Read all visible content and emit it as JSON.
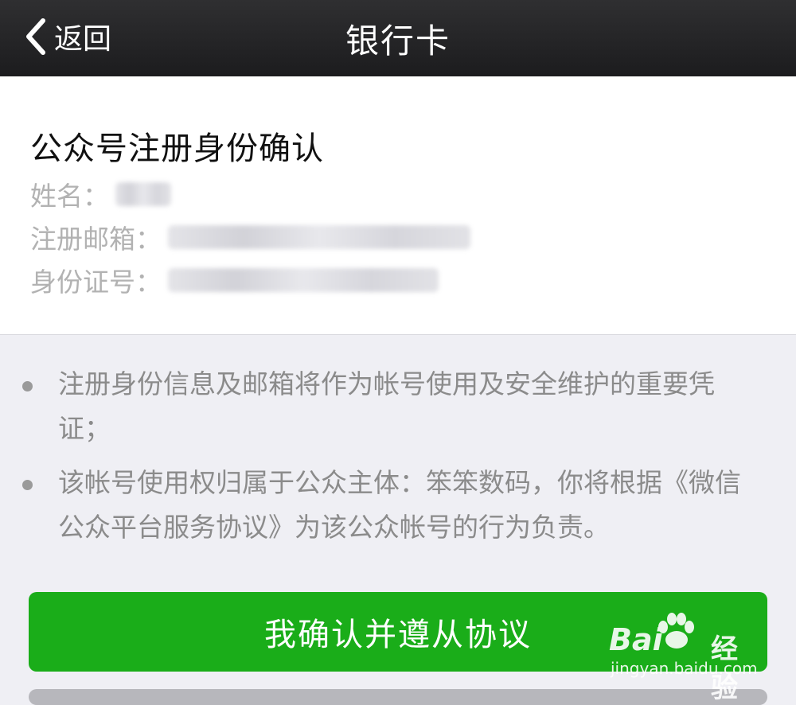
{
  "nav": {
    "back_label": "返回",
    "title": "银行卡"
  },
  "card": {
    "title": "公众号注册身份确认",
    "fields": [
      {
        "label": "姓名："
      },
      {
        "label": "注册邮箱："
      },
      {
        "label": "身份证号："
      }
    ]
  },
  "notes": [
    {
      "text": "注册身份信息及邮箱将作为帐号使用及安全维护的重要凭证；"
    },
    {
      "text": "该帐号使用权归属于公众主体：笨笨数码，你将根据《微信公众平台服务协议》为该公众帐号的行为负责。"
    }
  ],
  "confirm_button": {
    "label": "我确认并遵从协议"
  },
  "watermark": {
    "logo": "Bai",
    "logo_suffix": "经验",
    "url": "jingyan.baidu.com"
  },
  "colors": {
    "navbar": "#1c1c1e",
    "primary_green": "#1aad19",
    "background": "#efeff4",
    "label_gray": "#b2b2b2",
    "note_gray": "#8b8b8b"
  }
}
